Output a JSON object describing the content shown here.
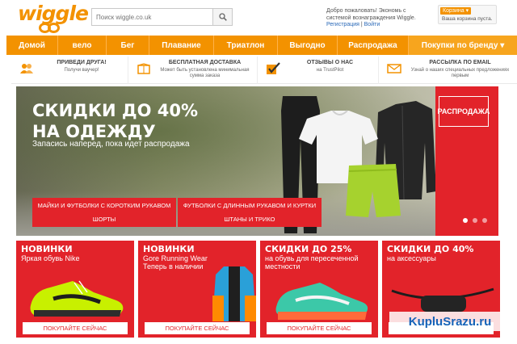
{
  "header": {
    "logo_text": "wiggle",
    "search_placeholder": "Поиск wiggle.co.uk",
    "welcome_line1": "Добро пожаловать! Экономь с",
    "welcome_line2": "системой вознаграждения Wiggle.",
    "register_link": "Регистрация",
    "login_link": "Войти",
    "basket_label": "Корзина",
    "basket_status": "Ваша корзина пуста."
  },
  "nav": {
    "items": [
      "Домой",
      "вело",
      "Бег",
      "Плавание",
      "Триатлон",
      "Выгодно",
      "Распродажа",
      "Покупки по бренду"
    ]
  },
  "usps": [
    {
      "title": "ПРИВЕДИ ДРУГА!",
      "text": "Получи ваучер!",
      "icon": "people-icon"
    },
    {
      "title": "БЕСПЛАТНАЯ ДОСТАВКА",
      "text": "Может быть установлена минимальная сумма заказа",
      "icon": "delivery-box-icon"
    },
    {
      "title": "ОТЗЫВЫ О НАС",
      "text": "на TrustPilot",
      "icon": "checkmark-icon"
    },
    {
      "title": "РАССЫЛКА ПО EMAIL",
      "text": "Узнай о наших специальных предложениях первым",
      "icon": "envelope-icon"
    }
  ],
  "hero": {
    "title_line1": "СКИДКИ ДО 40%",
    "title_line2": "НА ОДЕЖДУ",
    "subtitle": "Запасись наперед, пока идет распродажа",
    "sale_flag": "РАСПРОДАЖА",
    "buttons": [
      "МАЙКИ И ФУТБОЛКИ С КОРОТКИМ РУКАВОМ",
      "ФУТБОЛКИ С ДЛИННЫМ РУКАВОМ И КУРТКИ",
      "ШОРТЫ",
      "ШТАНЫ И ТРИКО"
    ],
    "slides_total": 3,
    "active_slide": 1
  },
  "tiles": [
    {
      "title": "НОВИНКИ",
      "subtitle": "Яркая обувь Nike",
      "cta": "ПОКУПАЙТЕ СЕЙЧАС",
      "accent": "#c8f000"
    },
    {
      "title": "НОВИНКИ",
      "subtitle": "Gore Running Wear Теперь в наличии",
      "cta": "ПОКУПАЙТЕ СЕЙЧАС",
      "accent": "#2aa0d8"
    },
    {
      "title": "СКИДКИ ДО 25%",
      "subtitle": "на обувь для пересеченной местности",
      "cta": "ПОКУПАЙТЕ СЕЙЧАС",
      "accent": "#3cc8a8"
    },
    {
      "title": "СКИДКИ ДО 40%",
      "subtitle": "на аксессуары",
      "cta": "",
      "accent": "#e2232a"
    }
  ],
  "watermark": "KupluSrazu.ru",
  "colors": {
    "brand_orange": "#f39200",
    "promo_red": "#e2232a",
    "link_blue": "#2a69b8"
  }
}
